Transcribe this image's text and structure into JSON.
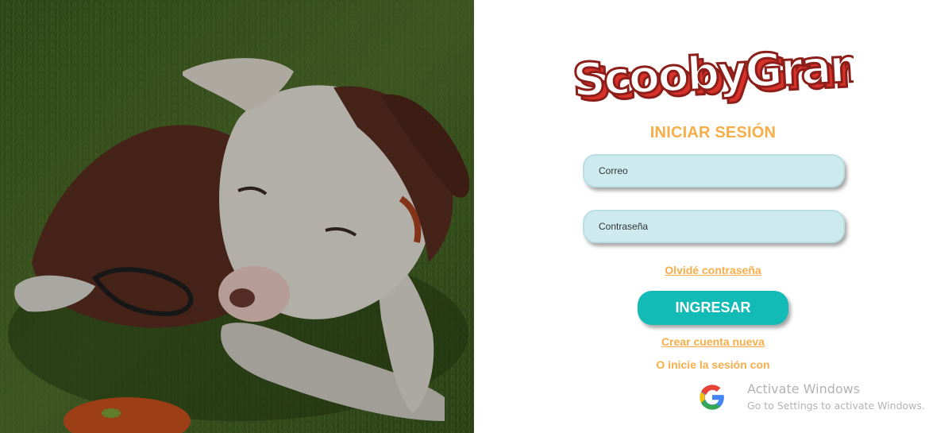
{
  "photo": {
    "alt": "dog lying on grass"
  },
  "logo": {
    "text": "ScoobyGram",
    "colors": {
      "fill": "#ffffff",
      "outline": "#8c1f1a",
      "shadow": "#d9322b"
    }
  },
  "login": {
    "title": "INICIAR SESIÓN",
    "email_placeholder": "Correo",
    "password_placeholder": "Contraseña",
    "forgot_link": "Olvidé contraseña",
    "submit_label": "INGRESAR",
    "create_link": "Crear cuenta nueva",
    "alt_login_text": "O inicie la sesión con",
    "google_icon": "google-g-icon"
  },
  "watermark": {
    "line1": "Activate Windows",
    "line2": "Go to Settings to activate Windows."
  },
  "colors": {
    "accent_orange": "#f7ad48",
    "button_teal": "#13bbb7",
    "input_bg": "#cdeaee"
  }
}
